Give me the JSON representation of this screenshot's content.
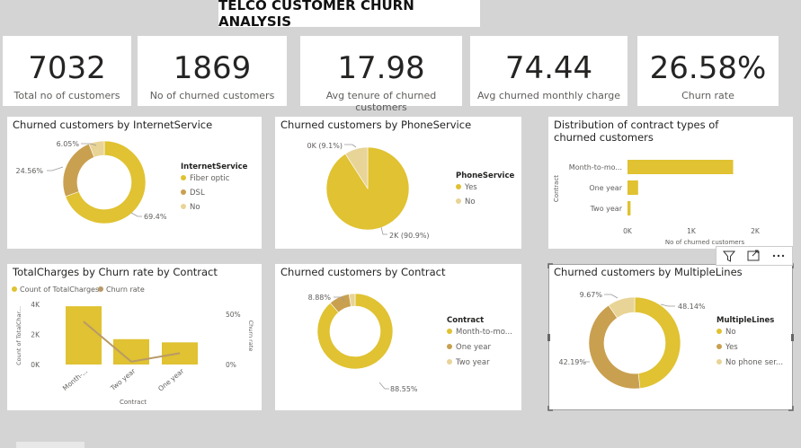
{
  "report_title": "TELCO CUSTOMER CHURN ANALYSIS",
  "colors": {
    "primary": "#e0c232",
    "brown": "#c9a050",
    "light": "#e8d497",
    "line": "#b89a68"
  },
  "kpis": [
    {
      "value": "7032",
      "label": "Total no of customers"
    },
    {
      "value": "1869",
      "label": "No of churned customers"
    },
    {
      "value": "17.98",
      "label": "Avg tenure of churned customers"
    },
    {
      "value": "74.44",
      "label": "Avg churned monthly charge"
    },
    {
      "value": "26.58%",
      "label": "Churn rate"
    }
  ],
  "chart_data": [
    {
      "id": "internet",
      "type": "pie",
      "title": "Churned customers by InternetService",
      "legend_title": "InternetService",
      "categories": [
        "Fiber optic",
        "DSL",
        "No"
      ],
      "values": [
        69.4,
        24.56,
        6.05
      ],
      "data_labels": [
        "69.4%",
        "24.56%",
        "6.05%"
      ]
    },
    {
      "id": "phone",
      "type": "pie",
      "title": "Churned customers by PhoneService",
      "legend_title": "PhoneService",
      "categories": [
        "Yes",
        "No"
      ],
      "values": [
        90.9,
        9.1
      ],
      "data_labels": [
        "2K (90.9%)",
        "0K (9.1%)"
      ]
    },
    {
      "id": "contract_bar",
      "type": "bar",
      "title": "Distribution of contract types of churned customers",
      "ylabel": "Contract",
      "xlabel": "No of churned customers",
      "categories": [
        "Month-to-mo...",
        "One year",
        "Two year"
      ],
      "values": [
        1655,
        166,
        48
      ],
      "xlim": [
        0,
        2000
      ],
      "x_ticks": [
        0,
        1000,
        2000
      ],
      "x_tick_labels": [
        "0K",
        "1K",
        "2K"
      ]
    },
    {
      "id": "combo",
      "type": "bar",
      "title": "TotalCharges by Churn rate by Contract",
      "legend": [
        "Count of TotalCharges",
        "Churn rate"
      ],
      "xlabel": "Contract",
      "ylabel": "Count of TotalChar...",
      "y2label": "Churn rate",
      "categories": [
        "Month-...",
        "Two year",
        "One year"
      ],
      "series": [
        {
          "name": "Count of TotalCharges",
          "values": [
            3875,
            1685,
            1472
          ]
        },
        {
          "name": "Churn rate",
          "values": [
            42.7,
            2.8,
            11.3
          ]
        }
      ],
      "ylim": [
        0,
        4000
      ],
      "y_ticks": [
        0,
        2000,
        4000
      ],
      "y_tick_labels": [
        "0K",
        "2K",
        "4K"
      ],
      "y2lim": [
        0,
        50
      ],
      "y2_ticks": [
        0,
        50
      ],
      "y2_tick_labels": [
        "0%",
        "50%"
      ]
    },
    {
      "id": "contract_pie",
      "type": "pie",
      "title": "Churned customers by Contract",
      "legend_title": "Contract",
      "categories": [
        "Month-to-mo...",
        "One year",
        "Two year"
      ],
      "values": [
        88.55,
        8.88,
        2.57
      ],
      "data_labels": [
        "88.55%",
        "8.88%",
        ""
      ]
    },
    {
      "id": "multilines",
      "type": "pie",
      "title": "Churned customers by MultipleLines",
      "legend_title": "MultipleLines",
      "categories": [
        "No",
        "Yes",
        "No phone ser..."
      ],
      "values": [
        48.14,
        42.19,
        9.67
      ],
      "data_labels": [
        "48.14%",
        "42.19%",
        "9.67%"
      ]
    }
  ]
}
